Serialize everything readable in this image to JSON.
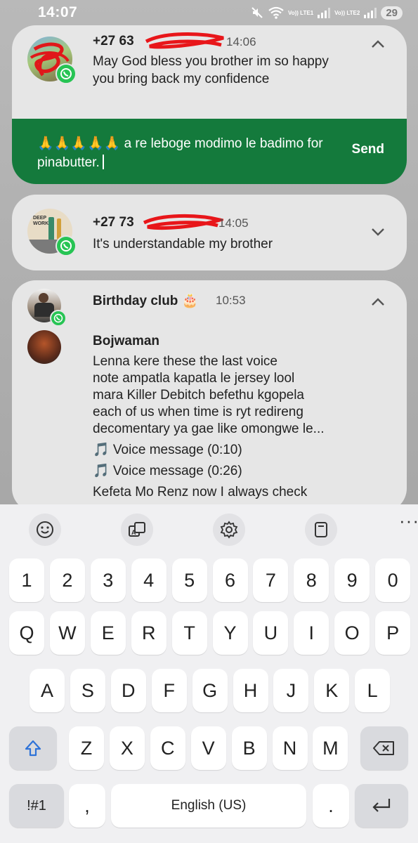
{
  "status_bar": {
    "time": "14:07",
    "lte1": "Vo)) LTE1",
    "lte2": "Vo)) LTE2",
    "battery": "29"
  },
  "notifications": [
    {
      "sender": "+27 63",
      "time": "14:06",
      "message": "May God bless you brother im so happy you bring back my confidence",
      "reply_text": "🙏🙏🙏🙏🙏 a re leboge modimo le badimo for pinabutter.",
      "send_label": "Send",
      "expanded": true
    },
    {
      "sender": "+27 73",
      "time": "14:05",
      "message": "It's understandable my brother",
      "avatar_text": "DEEP WORK",
      "expanded": false
    },
    {
      "sender": "Birthday club 🎂",
      "time": "10:53",
      "expanded": true,
      "sub_sender": "Bojwaman",
      "lines": [
        "Lenna kere these the last voice",
        "note ampatla kapatla le jersey lool",
        "mara Killer Debitch befethu kgopela",
        "each of us when time is ryt redireng",
        "decomentary ya gae like omongwe le..."
      ],
      "voice_messages": [
        "🎵 Voice message (0:10)",
        "🎵 Voice message (0:26)"
      ],
      "last_line": "Kefeta Mo Renz now I always check"
    }
  ],
  "keyboard": {
    "toolbar": [
      "emoji-icon",
      "translate-icon",
      "settings-icon",
      "clipboard-icon",
      "more-icon"
    ],
    "number_row": [
      "1",
      "2",
      "3",
      "4",
      "5",
      "6",
      "7",
      "8",
      "9",
      "0"
    ],
    "row1": [
      "Q",
      "W",
      "E",
      "R",
      "T",
      "Y",
      "U",
      "I",
      "O",
      "P"
    ],
    "row2": [
      "A",
      "S",
      "D",
      "F",
      "G",
      "H",
      "J",
      "K",
      "L"
    ],
    "row3": [
      "Z",
      "X",
      "C",
      "V",
      "B",
      "N",
      "M"
    ],
    "symbols_label": "!#1",
    "comma_label": ",",
    "space_label": "English (US)",
    "period_label": ".",
    "colors": {
      "accent_green": "#147a3c",
      "whatsapp_green": "#27c454",
      "shift_blue": "#2f73d8"
    }
  }
}
